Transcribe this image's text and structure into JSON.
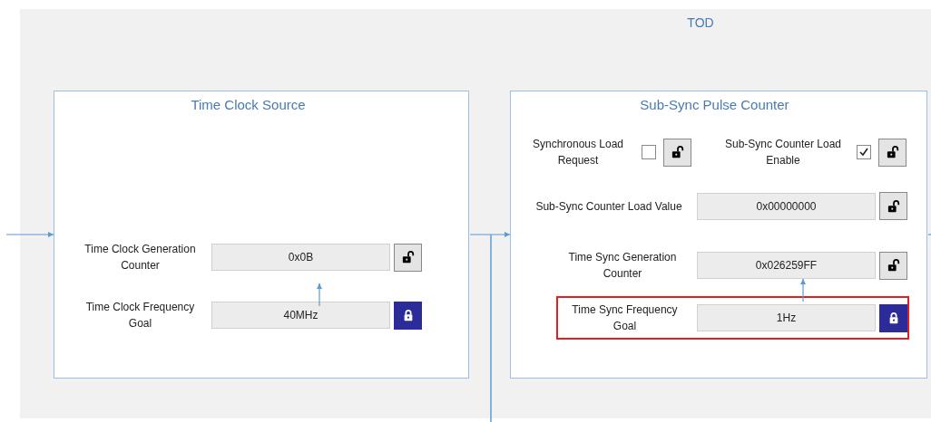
{
  "diagram": {
    "title": "TOD"
  },
  "panels": [
    {
      "title": "Time Clock Source",
      "fields": [
        {
          "label": "Time Clock Generation Counter",
          "value": "0x0B",
          "locked": false,
          "highlighted": false
        },
        {
          "label": "Time Clock Frequency Goal",
          "value": "40MHz",
          "locked": true,
          "highlighted": false
        }
      ]
    },
    {
      "title": "Sub-Sync Pulse Counter",
      "toggles": [
        {
          "label": "Synchronous Load Request",
          "checked": false,
          "locked": false
        },
        {
          "label": "Sub-Sync Counter Load Enable",
          "checked": true,
          "locked": false
        }
      ],
      "fields": [
        {
          "label": "Sub-Sync Counter Load Value",
          "value": "0x00000000",
          "locked": false,
          "highlighted": false
        },
        {
          "label": "Time Sync Generation Counter",
          "value": "0x026259FF",
          "locked": false,
          "highlighted": false
        },
        {
          "label": "Time Sync Frequency Goal",
          "value": "1Hz",
          "locked": true,
          "highlighted": true
        }
      ]
    }
  ]
}
